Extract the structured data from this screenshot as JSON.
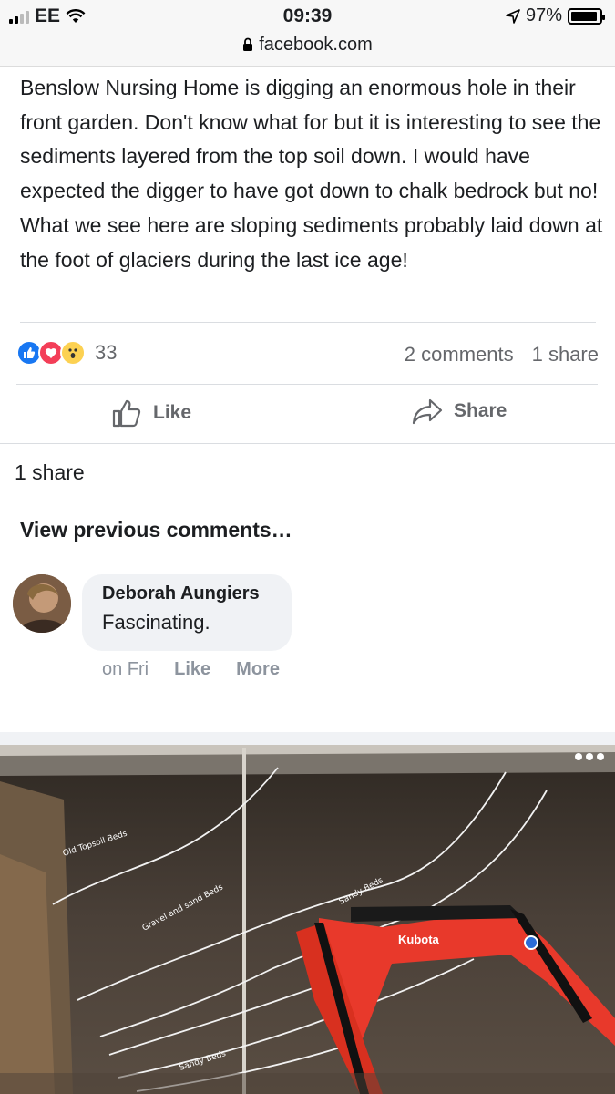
{
  "status_bar": {
    "carrier": "EE",
    "time": "09:39",
    "battery": "97%",
    "battery_level": 0.97,
    "url": "facebook.com"
  },
  "post": {
    "text": "Benslow Nursing Home is digging an enormous hole in their front garden. Don't know what for but it is interesting to see the sediments layered from the top soil down. I would have expected the digger to have got down to chalk bedrock but no! What we see here are sloping sediments probably laid down at the foot of glaciers during the last ice age!",
    "reaction_count": "33",
    "comments_count": "2 comments",
    "shares_count": "1 share",
    "like_label": "Like",
    "share_label": "Share"
  },
  "share_summary": "1 share",
  "comments": {
    "view_previous": "View previous comments…",
    "items": [
      {
        "author": "Deborah Aungiers",
        "text": "Fascinating.",
        "time": "on Fri",
        "like": "Like",
        "more": "More"
      }
    ]
  },
  "photo": {
    "labels": [
      "Old Topsoil Beds",
      "Gravel and sand Beds",
      "Sandy Beds",
      "Sandy Beds"
    ],
    "brand": "Kubota"
  },
  "colors": {
    "accent": "#1877f2",
    "love": "#f33e58",
    "wow": "#fcd152",
    "muted": "#65676b",
    "digger": "#e8392b"
  },
  "icons": [
    "signal-icon",
    "wifi-icon",
    "location-icon",
    "battery-icon",
    "lock-icon",
    "like-icon",
    "share-icon",
    "more-options-icon"
  ]
}
